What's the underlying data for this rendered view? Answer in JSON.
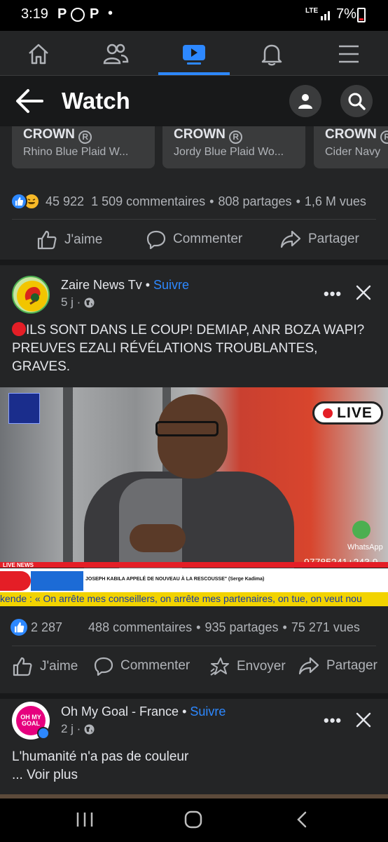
{
  "status_bar": {
    "time": "3:19",
    "notif_icons": [
      "P",
      "whatsapp-icon",
      "P"
    ],
    "dot": "•",
    "network": "LTE",
    "battery": "7%"
  },
  "nav": {
    "items": [
      "home-icon",
      "friends-icon",
      "watch-icon",
      "notifications-icon",
      "menu-icon"
    ],
    "active": "watch-icon"
  },
  "header": {
    "title": "Watch"
  },
  "products": [
    {
      "brand": "CROWN",
      "name": "Rhino Blue Plaid W..."
    },
    {
      "brand": "CROWN",
      "name": "Jordy Blue Plaid Wo..."
    },
    {
      "brand": "CROWN",
      "name": "Cider Navy"
    }
  ],
  "post1_stats": {
    "reactions": "45 922",
    "comments": "1 509 commentaires",
    "shares": "808 partages",
    "views": "1,6 M vues"
  },
  "actions1": {
    "like": "J'aime",
    "comment": "Commenter",
    "share": "Partager"
  },
  "post2": {
    "author": "Zaire News Tv",
    "follow": "Suivre",
    "time": "5 j ·",
    "text": "ILS SONT DANS LE COUP! DEMIAP, ANR BOZA WAPI? PREUVES EZALI RÉVÉLATIONS TROUBLANTES, GRAVES.",
    "video": {
      "live": "LIVE",
      "live_news": "LIVE NEWS",
      "headline": "JOSEPH KABILA APPELÉ DE NOUVEAU À LA RESCOUSSE\" (Serge Kadima)",
      "ticker": "kende : « On arrête mes conseillers, on arrête mes partenaires, on tue, on veut nou",
      "phone": "97785241+243 9",
      "whatsapp": "WhatsApp"
    },
    "reactions": "2 287",
    "comments": "488 commentaires",
    "shares": "935 partages",
    "views": "75 271 vues"
  },
  "actions2": {
    "like": "J'aime",
    "comment": "Commenter",
    "send": "Envoyer",
    "share": "Partager"
  },
  "post3": {
    "author": "Oh My Goal - France",
    "follow": "Suivre",
    "time": "2 j ·",
    "text": "L'humanité n'a pas de couleur",
    "more": "... Voir plus",
    "avatar_text": "OH MY GOAL"
  },
  "colors": {
    "accent": "#2d88ff",
    "bg": "#18191a",
    "card": "#242526",
    "live_red": "#e41e26"
  }
}
